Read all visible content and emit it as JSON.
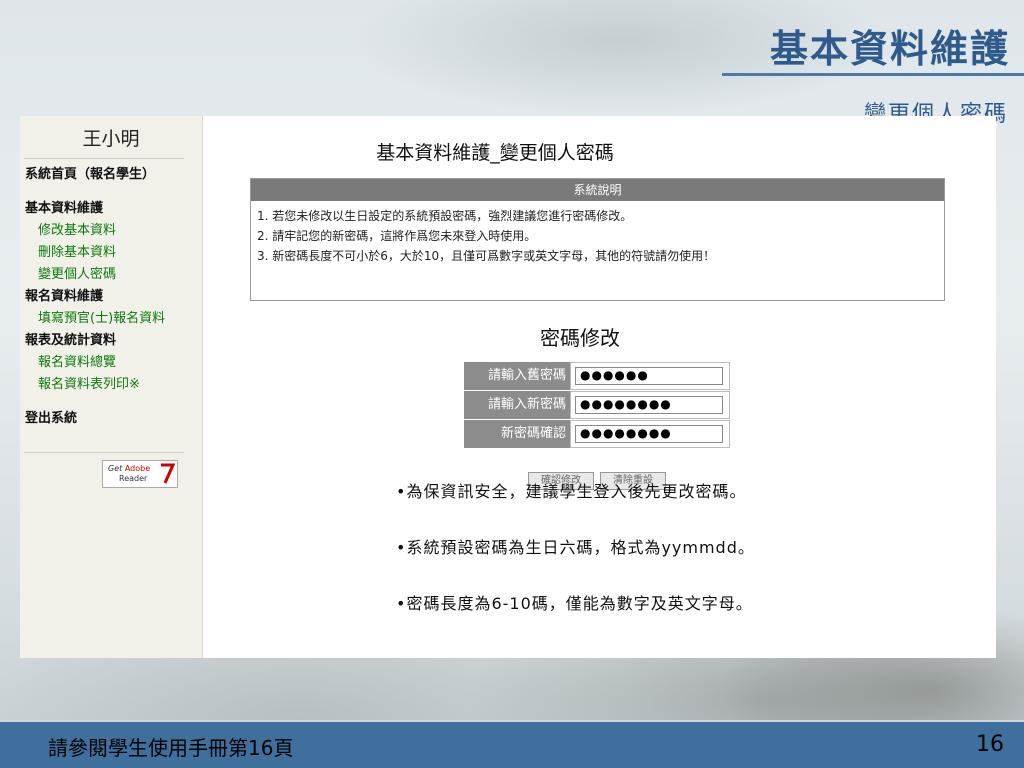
{
  "slide": {
    "title": "基本資料維護",
    "subtitle": "變更個人密碼",
    "footer_text": "請參閱學生使用手冊第16頁",
    "page_number": "16"
  },
  "sidebar": {
    "user_name": "王小明",
    "home_link": "系統首頁",
    "role": "（報名學生）",
    "sections": [
      {
        "title": "基本資料維護",
        "items": [
          "修改基本資料",
          "刪除基本資料",
          "變更個人密碼"
        ]
      },
      {
        "title": "報名資料維護",
        "items": [
          "填寫預官(士)報名資料"
        ]
      },
      {
        "title": "報表及統計資料",
        "items": [
          "報名資料總覽",
          "報名資料表列印※"
        ]
      }
    ],
    "logout": "登出系統",
    "adobe_badge": {
      "get": "Get",
      "brand": "Adobe",
      "product": "Reader"
    }
  },
  "main": {
    "title": "基本資料維護_變更個人密碼",
    "info_header": "系統說明",
    "info_items": [
      "1. 若您未修改以生日設定的系統預設密碼，強烈建議您進行密碼修改。",
      "2. 請牢記您的新密碼，這將作爲您未來登入時使用。",
      "3. 新密碼長度不可小於6，大於10，且僅可爲數字或英文字母，其他的符號請勿使用！"
    ],
    "password_section_title": "密碼修改",
    "fields": [
      {
        "label": "請輸入舊密碼",
        "value": "●●●●●●"
      },
      {
        "label": "請輸入新密碼",
        "value": "●●●●●●●●"
      },
      {
        "label": "新密碼確認",
        "value": "●●●●●●●●"
      }
    ],
    "buttons": {
      "confirm": "確認修改",
      "clear": "清除重設"
    }
  },
  "notes": [
    "•為保資訊安全，建議學生登入後先更改密碼。",
    "•系統預設密碼為生日六碼，格式為yymmdd。",
    "•密碼長度為6-10碼，僅能為數字及英文字母。"
  ]
}
